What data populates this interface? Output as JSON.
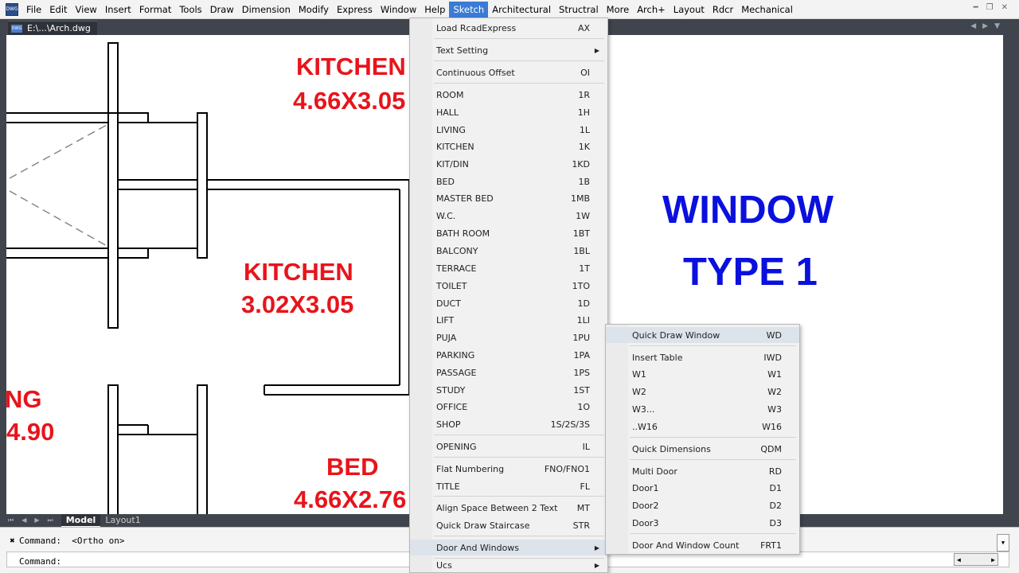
{
  "menubar": {
    "app_icon": "DWG",
    "items": [
      "File",
      "Edit",
      "View",
      "Insert",
      "Format",
      "Tools",
      "Draw",
      "Dimension",
      "Modify",
      "Express",
      "Window",
      "Help",
      "Sketch",
      "Architectural",
      "Structral",
      "More",
      "Arch+",
      "Layout",
      "Rdcr",
      "Mechanical"
    ],
    "active": "Sketch"
  },
  "doc_tab": {
    "title": "E:\\...\\Arch.dwg",
    "icon": "DWG"
  },
  "drawing": {
    "texts": [
      {
        "text": "KITCHEN",
        "color": "#e8141b"
      },
      {
        "text": "4.66X3.05",
        "color": "#e8141b"
      },
      {
        "text": "KITCHEN",
        "color": "#e8141b"
      },
      {
        "text": "3.02X3.05",
        "color": "#e8141b"
      },
      {
        "text": "NG",
        "color": "#e8141b"
      },
      {
        "text": "4.90",
        "color": "#e8141b"
      },
      {
        "text": "BED",
        "color": "#e8141b"
      },
      {
        "text": "4.66X2.76",
        "color": "#e8141b"
      },
      {
        "text": "WINDOW",
        "color": "#0a10dd"
      },
      {
        "text": "TYPE 1",
        "color": "#0a10dd"
      }
    ]
  },
  "layout_tabs": {
    "model": "Model",
    "layout1": "Layout1"
  },
  "command": {
    "line1_prompt": "Command:",
    "line1_value": "<Ortho on>",
    "line2_prompt": "Command:"
  },
  "sketch_menu": [
    {
      "label": "Load RcadExpress",
      "key": "AX"
    },
    {
      "label": "Text Setting",
      "key": "",
      "submenu": true
    },
    {
      "label": "Continuous Offset",
      "key": "OI"
    },
    {
      "label": "ROOM",
      "key": "1R"
    },
    {
      "label": "HALL",
      "key": "1H"
    },
    {
      "label": "LIVING",
      "key": "1L"
    },
    {
      "label": "KITCHEN",
      "key": "1K"
    },
    {
      "label": "KIT/DIN",
      "key": "1KD"
    },
    {
      "label": "BED",
      "key": "1B"
    },
    {
      "label": "MASTER BED",
      "key": "1MB"
    },
    {
      "label": "W.C.",
      "key": "1W"
    },
    {
      "label": "BATH ROOM",
      "key": "1BT"
    },
    {
      "label": "BALCONY",
      "key": "1BL"
    },
    {
      "label": "TERRACE",
      "key": "1T"
    },
    {
      "label": "TOILET",
      "key": "1TO"
    },
    {
      "label": "DUCT",
      "key": "1D"
    },
    {
      "label": "LIFT",
      "key": "1LI"
    },
    {
      "label": "PUJA",
      "key": "1PU"
    },
    {
      "label": "PARKING",
      "key": "1PA"
    },
    {
      "label": "PASSAGE",
      "key": "1PS"
    },
    {
      "label": "STUDY",
      "key": "1ST"
    },
    {
      "label": "OFFICE",
      "key": "1O"
    },
    {
      "label": "SHOP",
      "key": "1S/2S/3S"
    },
    {
      "label": "OPENING",
      "key": "IL"
    },
    {
      "label": "Flat Numbering",
      "key": "FNO/FNO1"
    },
    {
      "label": "TITLE",
      "key": "FL"
    },
    {
      "label": "Align Space Between 2 Text",
      "key": "MT"
    },
    {
      "label": "Quick Draw Staircase",
      "key": "STR"
    },
    {
      "label": "Door And Windows",
      "key": "",
      "submenu": true
    },
    {
      "label": "Ucs",
      "key": "",
      "submenu": true
    }
  ],
  "door_menu": [
    {
      "label": "Quick Draw Window",
      "key": "WD"
    },
    {
      "label": "Insert Table",
      "key": "IWD"
    },
    {
      "label": "W1",
      "key": "W1"
    },
    {
      "label": "W2",
      "key": "W2"
    },
    {
      "label": "W3...",
      "key": "W3"
    },
    {
      "label": "..W16",
      "key": "W16"
    },
    {
      "label": "Quick Dimensions",
      "key": "QDM"
    },
    {
      "label": "Multi Door",
      "key": "RD"
    },
    {
      "label": "Door1",
      "key": "D1"
    },
    {
      "label": "Door2",
      "key": "D2"
    },
    {
      "label": "Door3",
      "key": "D3"
    },
    {
      "label": "Door And Window Count",
      "key": "FRT1"
    }
  ]
}
